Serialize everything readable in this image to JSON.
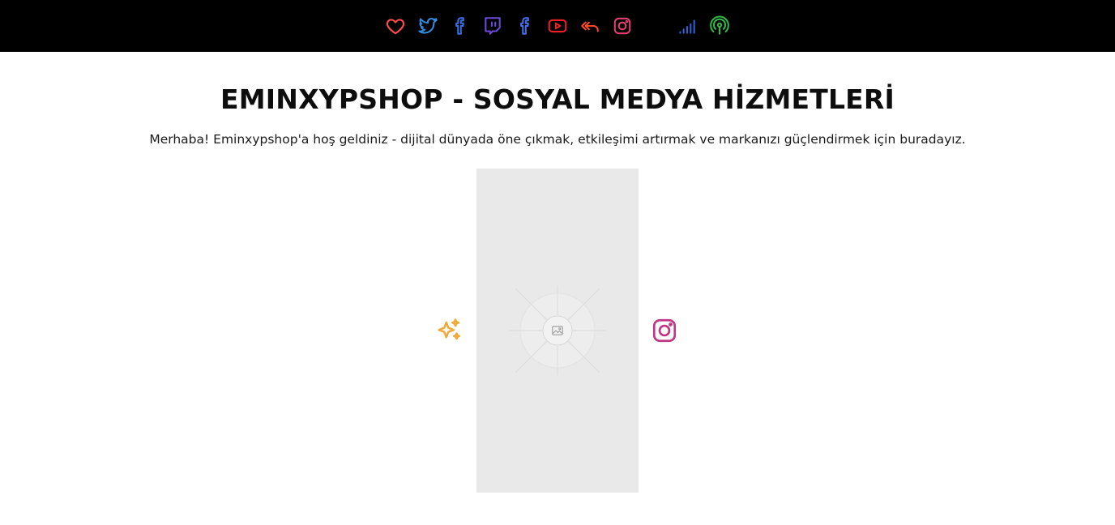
{
  "header": {
    "nav_icons": [
      {
        "name": "heart-icon",
        "color": "#ff4b4b"
      },
      {
        "name": "twitter-icon",
        "color": "#2f8fe6"
      },
      {
        "name": "facebook-icon",
        "color": "#3b6fe0"
      },
      {
        "name": "twitch-icon",
        "color": "#6b4ad6"
      },
      {
        "name": "facebook-icon",
        "color": "#4a6ee8"
      },
      {
        "name": "youtube-icon",
        "color": "#ef2020"
      },
      {
        "name": "reply-all-icon",
        "color": "#ff4a2a"
      },
      {
        "name": "instagram-icon",
        "color": "#e23d74"
      },
      {
        "name": "signal-icon",
        "color": "#2a62d6"
      },
      {
        "name": "podcast-icon",
        "color": "#2fb84a"
      }
    ]
  },
  "main": {
    "title": "EMINXYPSHOP - SOSYAL MEDYA HİZMETLERİ",
    "subtitle": "Merhaba! Eminxypshop'a hoş geldiniz - dijital dünyada öne çıkmak, etkileşimi artırmak ve markanızı güçlendirmek için buradayız.",
    "image_placeholder": {
      "background": "#e9e9e9",
      "icon": "image-icon"
    },
    "left_icon": {
      "name": "sparkles-icon",
      "color": "#f2a93b"
    },
    "right_icon": {
      "name": "instagram-icon",
      "color": "#c13584"
    }
  }
}
